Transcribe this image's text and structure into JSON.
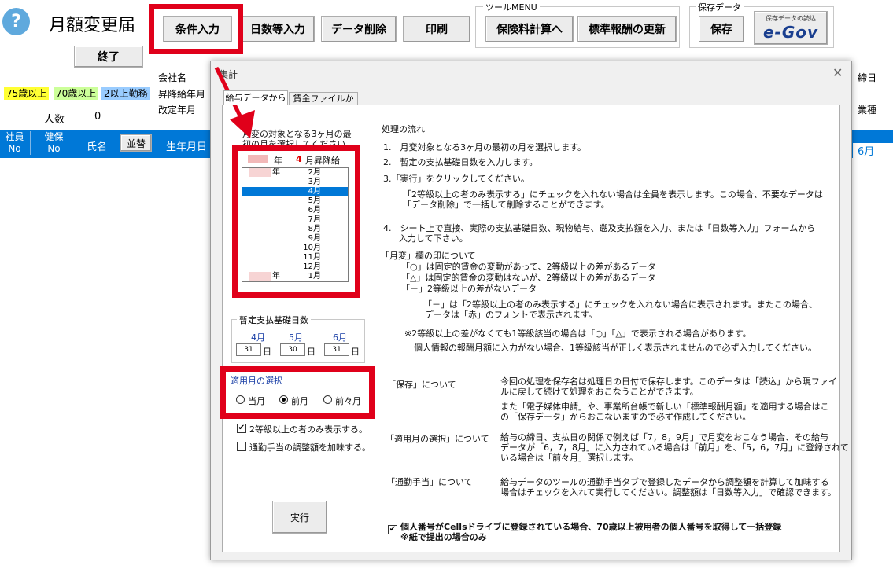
{
  "window": {
    "title": "月額変更届",
    "help_icon": "?",
    "end_button": "終了"
  },
  "toolbar": {
    "buttons": [
      "条件入力",
      "日数等入力",
      "データ削除",
      "印刷"
    ],
    "tool_menu": {
      "title": "ツールMENU",
      "buttons": [
        "保険料計算へ",
        "標準報酬の更新"
      ]
    },
    "save_group": {
      "title": "保存データ",
      "save": "保存",
      "egov_caption": "保存データの読込",
      "egov_logo": "e-Gov"
    }
  },
  "legend": {
    "items": [
      "75歳以上",
      "70歳以上",
      "2以上勤務"
    ],
    "colors": [
      "#ffff33",
      "#ccff99",
      "#99ccff"
    ]
  },
  "info": {
    "labels": [
      "会社名",
      "昇降給年月",
      "改定年月"
    ],
    "right_labels": [
      "締日",
      "業種"
    ],
    "count_label": "人数",
    "count_value": "0"
  },
  "table_header": {
    "emp_no": [
      "社員",
      "No"
    ],
    "ins_no": [
      "健保",
      "No"
    ],
    "name": "氏名",
    "sort_button": "並替",
    "birth": "生年月日",
    "right_cell": "6月",
    "color": "#0078d7"
  },
  "dialog": {
    "title": "集計",
    "tabs": [
      "給与データから",
      "賃金ファイルから"
    ],
    "month_prompt": [
      "月変の対象となる3ヶ月の最",
      "初の月を選択してください。"
    ],
    "list_header": {
      "year_label": "年",
      "month_num": "4",
      "suffix": "月昇降給"
    },
    "list_items": [
      {
        "year": "年",
        "month": "2月"
      },
      {
        "year": "",
        "month": "3月"
      },
      {
        "year": "",
        "month": "4月"
      },
      {
        "year": "",
        "month": "5月"
      },
      {
        "year": "",
        "month": "6月"
      },
      {
        "year": "",
        "month": "7月"
      },
      {
        "year": "",
        "month": "8月"
      },
      {
        "year": "",
        "month": "9月"
      },
      {
        "year": "",
        "month": "10月"
      },
      {
        "year": "",
        "month": "11月"
      },
      {
        "year": "",
        "month": "12月"
      },
      {
        "year": "年",
        "month": "1月"
      }
    ],
    "selected_index": 2,
    "days_group": {
      "title": "暫定支払基礎日数",
      "months": [
        "4月",
        "5月",
        "6月"
      ],
      "values": [
        "31",
        "30",
        "31"
      ],
      "unit": "日"
    },
    "apply_group": {
      "title": "適用月の選択",
      "options": [
        "当月",
        "前月",
        "前々月"
      ],
      "selected": 1
    },
    "checkboxes": [
      {
        "label": "2等級以上の者のみ表示する。",
        "checked": true
      },
      {
        "label": "通勤手当の調整額を加味する。",
        "checked": false
      }
    ],
    "run_button": "実行",
    "flow_title": "処理の流れ",
    "flow": [
      "1.　月変対象となる3ヶ月の最初の月を選択します。",
      "2.　暫定の支払基礎日数を入力します。",
      "3.「実行」をクリックしてください。",
      "「2等級以上の者のみ表示する」にチェックを入れない場合は全員を表示します。この場合、不要なデータは",
      "「データ削除」で一括して削除することができます。",
      "4.　シート上で直接、実際の支払基礎日数、現物給与、遡及支払額を入力、または「日数等入力」フォームから",
      "入力して下さい。"
    ],
    "marks_title": "「月変」欄の印について",
    "marks": [
      "「○」は固定的賃金の変動があって、2等級以上の差があるデータ",
      "「△」は固定的賃金の変動はないが、2等級以上の差があるデータ",
      "「－」2等級以上の差がないデータ",
      "「－」は「2等級以上の者のみ表示する」にチェックを入れない場合に表示されます。またこの場合、",
      "データは「赤」のフォントで表示されます。",
      "※2等級以上の差がなくても1等級該当の場合は「○」「△」で表示される場合があります。",
      "個人情報の報酬月額に入力がない場合、1等級該当が正しく表示されませんので必ず入力してください。"
    ],
    "notes": [
      {
        "title": "「保存」について",
        "lines": [
          "今回の処理を保存名は処理日の日付で保存します。このデータは「読込」から現ファイ",
          "ルに戻して続けて処理をおこなうことができます。",
          "",
          "また「電子媒体申請」や、事業所台帳で新しい「標準報酬月額」を適用する場合はこ",
          "の「保存データ」からおこないますので必ず作成してください。"
        ]
      },
      {
        "title": "「適用月の選択」について",
        "lines": [
          "給与の締日、支払日の関係で例えば「7，8，9月」で月変をおこなう場合、その給与",
          "データが「6，7，8月」に入力されている場合は「前月」を、「5，6，7月」に登録されて",
          "いる場合は「前々月」選択します。"
        ]
      },
      {
        "title": "「通勤手当」について",
        "lines": [
          "給与データのツールの通勤手当タブで登録したデータから調整額を計算して加味する",
          "場合はチェックを入れて実行してください。調整額は「日数等入力」で確認できます。"
        ]
      }
    ],
    "bottom_check": {
      "checked": true,
      "lines": [
        "個人番号がCellsドライブに登録されている場合、70歳以上被用者の個人番号を取得して一括登録",
        "※紙で提出の場合のみ"
      ]
    }
  }
}
